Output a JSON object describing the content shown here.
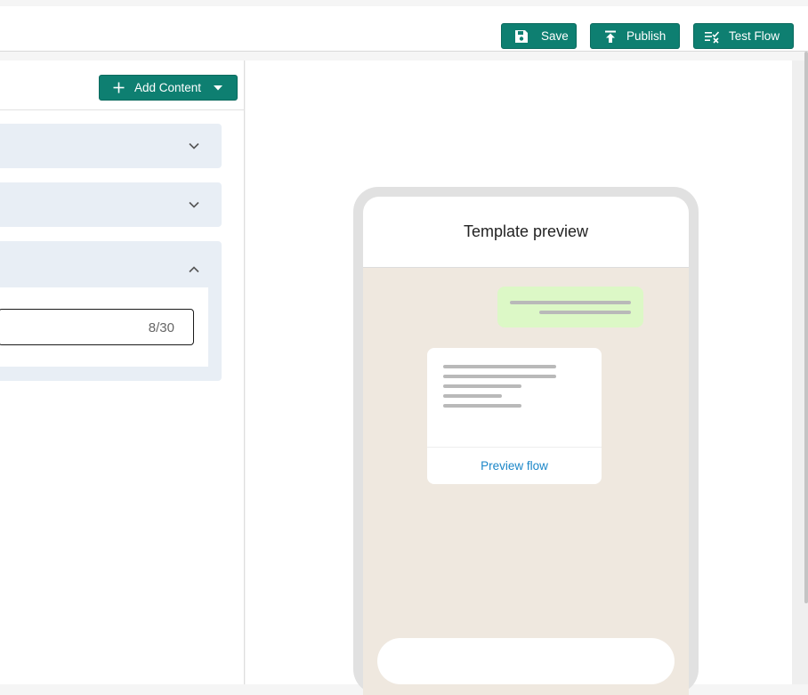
{
  "toolbar": {
    "save_label": "Save",
    "publish_label": "Publish",
    "test_flow_label": "Test Flow"
  },
  "editor": {
    "add_content_label": "Add Content",
    "sections": [
      {
        "expanded": false
      },
      {
        "expanded": false
      },
      {
        "expanded": true,
        "field_counter": "8/30"
      }
    ]
  },
  "preview": {
    "title": "Template preview",
    "card_link": "Preview flow"
  },
  "colors": {
    "primary": "#0e7f71",
    "accordion": "#e8eef5",
    "outgoing_bubble": "#dcf8c6",
    "chat_background": "#efe8df",
    "link": "#1a86c8"
  }
}
